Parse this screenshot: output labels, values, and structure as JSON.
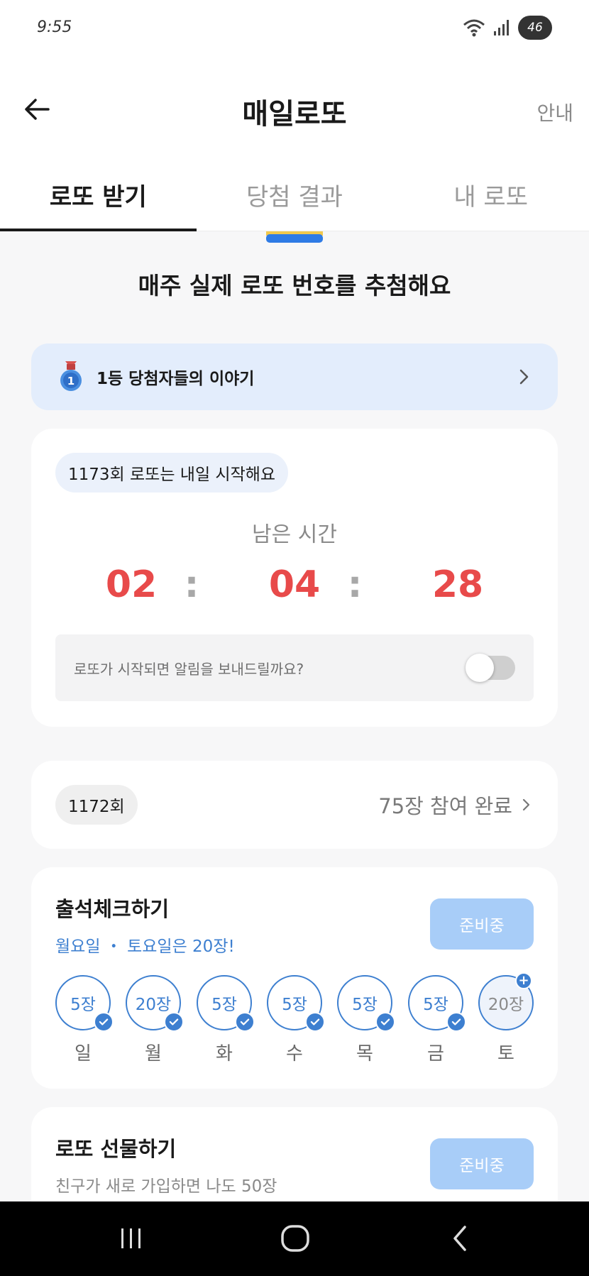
{
  "status_bar": {
    "time": "9:55",
    "battery": "46",
    "icons": [
      "wifi-icon",
      "signal-icon",
      "battery-icon"
    ]
  },
  "header": {
    "title": "매일로또",
    "guide": "안내",
    "back_icon": "arrow-left-icon"
  },
  "tabs": [
    {
      "label": "로또 받기",
      "active": true
    },
    {
      "label": "당첨 결과",
      "active": false
    },
    {
      "label": "내 로또",
      "active": false
    }
  ],
  "hero": {
    "text": "매주 실제 로또 번호를 추첨해요"
  },
  "story_banner": {
    "text": "1등 당첨자들의 이야기",
    "medal_number": "1"
  },
  "countdown": {
    "round_notice": "1173회 로또는 내일 시작해요",
    "remain_label": "남은 시간",
    "hours": "02",
    "minutes": "04",
    "seconds": "28",
    "separator": ":",
    "notify_text": "로또가 시작되면 알림을 보내드릴까요?",
    "notify_enabled": false
  },
  "past_round": {
    "round": "1172회",
    "status": "75장 참여 완료"
  },
  "attendance": {
    "title": "출석체크하기",
    "subtitle": "월요일 ・ 토요일은 20장!",
    "button": "준비중",
    "days": [
      {
        "amount": "5장",
        "day": "일",
        "checked": true
      },
      {
        "amount": "20장",
        "day": "월",
        "checked": true
      },
      {
        "amount": "5장",
        "day": "화",
        "checked": true
      },
      {
        "amount": "5장",
        "day": "수",
        "checked": true
      },
      {
        "amount": "5장",
        "day": "목",
        "checked": true
      },
      {
        "amount": "5장",
        "day": "금",
        "checked": true
      },
      {
        "amount": "20장",
        "day": "토",
        "checked": false
      }
    ],
    "accent_color": "#3d7fd0"
  },
  "gift": {
    "title": "로또 선물하기",
    "subtitle": "친구가 새로 가입하면 나도 50장",
    "button": "준비중"
  },
  "nav": {
    "icons": [
      "recent-apps-icon",
      "home-icon",
      "back-icon"
    ]
  },
  "colors": {
    "timer": "#e84a4a",
    "banner_bg": "#e3edfc",
    "button_disabled": "#a8cdf8"
  }
}
